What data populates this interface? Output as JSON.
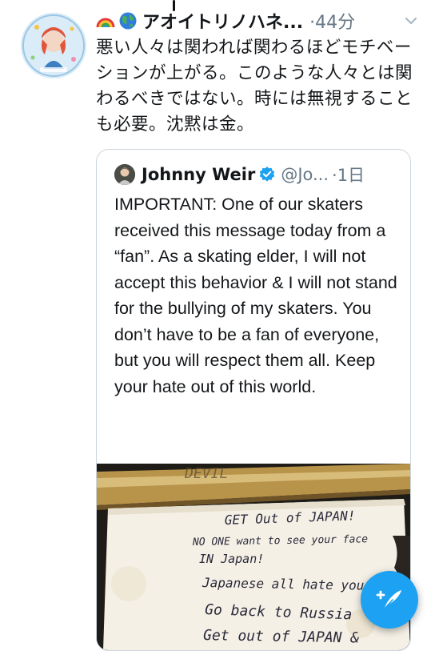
{
  "tweet": {
    "display_name": "アオイトリノハネ...",
    "timestamp": "·44分",
    "text": "悪い人々は関われば関わるほどモチベーションが上がる。このような人々とは関わるべきではない。時には無視することも必要。沈黙は金。",
    "emojis": [
      "rainbow-emoji",
      "globe-emoji"
    ]
  },
  "quoted_tweet": {
    "display_name": "Johnny Weir",
    "handle": "@Jo...",
    "timestamp": "·1日",
    "text": "IMPORTANT: One of our skaters received this message today from a “fan”. As a skating elder, I will not accept this behavior & I will not stand for the bullying of my skaters. You don’t have to be a fan of everyone, but you will respect them all. Keep your hate out of this world.",
    "image_lines": [
      "DEVIL",
      "GET Out of JAPAN!",
      "NO ONE want to see your face",
      "IN Japan!",
      "Japanese all hate you",
      "Go back to Russia",
      "Get out of JAPAN &"
    ]
  },
  "colors": {
    "accent": "#1da1f2",
    "secondary_text": "#657786"
  },
  "icons": {
    "menu": "chevron-down-icon",
    "verified": "verified-badge-icon",
    "compose": "compose-tweet-icon"
  }
}
